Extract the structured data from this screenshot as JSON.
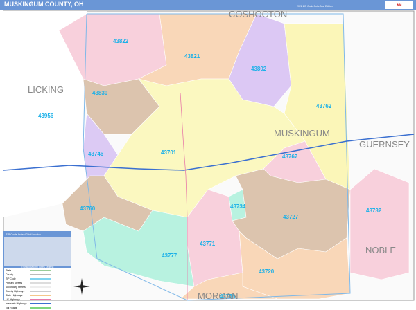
{
  "header": {
    "title": "MUSKINGUM COUNTY, OH",
    "edition": "2022 ZIP Code ColorCast Edition",
    "logo": "Marketmaps"
  },
  "zips": [
    {
      "code": "43822",
      "color": "#f8d0dc"
    },
    {
      "code": "43821",
      "color": "#f9d7b8"
    },
    {
      "code": "43802",
      "color": "#dcc8f4"
    },
    {
      "code": "43830",
      "color": "#dcc4ae"
    },
    {
      "code": "43956",
      "color": "#ffffff"
    },
    {
      "code": "43762",
      "color": "#fbf6b8"
    },
    {
      "code": "43746",
      "color": "#dccaf4"
    },
    {
      "code": "43701",
      "color": "#fbf8c0"
    },
    {
      "code": "43767",
      "color": "#f8d0dc"
    },
    {
      "code": "43760",
      "color": "#dcc4ae"
    },
    {
      "code": "43734",
      "color": "#b8f2e0"
    },
    {
      "code": "43727",
      "color": "#dcc4ae"
    },
    {
      "code": "43732",
      "color": "#f8d0dc"
    },
    {
      "code": "43771",
      "color": "#f8d0dc"
    },
    {
      "code": "43777",
      "color": "#b8f2e0"
    },
    {
      "code": "43720",
      "color": "#f9d7b8"
    },
    {
      "code": "43756",
      "color": "#f9d7b8"
    }
  ],
  "counties": [
    "LICKING",
    "COSHOCTON",
    "MUSKINGUM",
    "GUERNSEY",
    "NOBLE",
    "MORGAN"
  ],
  "legend": {
    "title": "ZIP Code Index/Grid Locator",
    "section": "Transportation / Cities Legend",
    "items": [
      "State",
      "County",
      "ZIP Code",
      "Primary Streets",
      "Secondary Streets",
      "County Highways",
      "State Highways",
      "US Highways",
      "Interstate Highways",
      "Toll Roads"
    ]
  }
}
